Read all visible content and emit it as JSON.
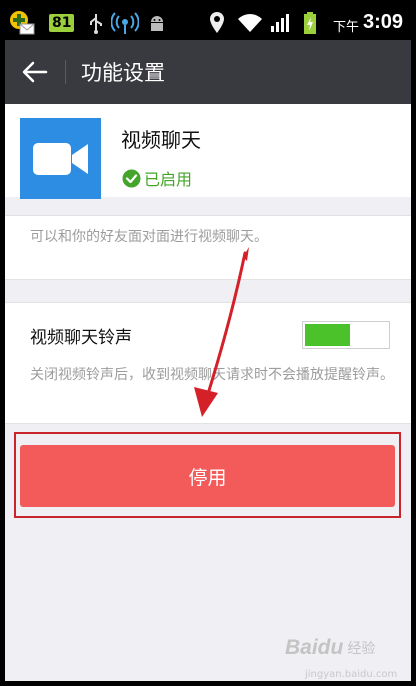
{
  "status_bar": {
    "badge": "81",
    "ampm": "下午",
    "time": "3:09",
    "icons": [
      "notification-plus-icon",
      "mail-icon",
      "usb-icon",
      "wifi-hotspot-icon",
      "android-icon",
      "location-icon",
      "wifi-icon",
      "signal-icon",
      "battery-icon"
    ]
  },
  "header": {
    "title": "功能设置",
    "back_icon": "back-arrow-icon"
  },
  "plugin": {
    "name": "视频聊天",
    "status": "已启用",
    "icon": "video-camera-icon",
    "status_icon": "check-circle-icon",
    "accent_color": "#2d8de2",
    "status_color": "#44a52a"
  },
  "description": "可以和你的好友面对面进行视频聊天。",
  "ringtone": {
    "label": "视频聊天铃声",
    "enabled": true,
    "note": "关闭视频铃声后，收到视频聊天请求时不会播放提醒铃声。",
    "toggle_color": "#4bc12a"
  },
  "disable_button": {
    "label": "停用",
    "color": "#f35b5b"
  },
  "annotation": {
    "color": "#d42028"
  },
  "watermark": {
    "text": "Baidu",
    "sub": "经验",
    "url": "jingyan.baidu.com"
  }
}
